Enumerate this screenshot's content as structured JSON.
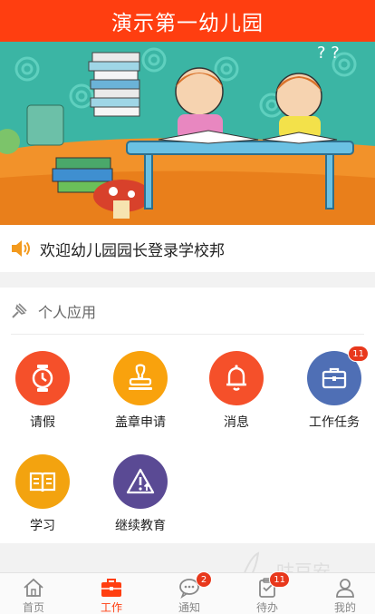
{
  "header": {
    "title": "演示第一幼儿园"
  },
  "banner": {
    "alt": "illustration"
  },
  "notice": {
    "text": "欢迎幼儿园园长登录学校邦"
  },
  "apps": {
    "section_title": "个人应用",
    "items": [
      {
        "label": "请假",
        "icon": "clock-icon",
        "color": "#f5502a"
      },
      {
        "label": "盖章申请",
        "icon": "stamp-icon",
        "color": "#f9a20d"
      },
      {
        "label": "消息",
        "icon": "bell-icon",
        "color": "#f5502a"
      },
      {
        "label": "工作任务",
        "icon": "briefcase-icon",
        "color": "#4f6fb5",
        "badge": "11"
      },
      {
        "label": "学习",
        "icon": "book-icon",
        "color": "#f3a30f"
      },
      {
        "label": "继续教育",
        "icon": "warning-icon",
        "color": "#5a4a94"
      }
    ]
  },
  "tabbar": {
    "items": [
      {
        "label": "首页",
        "icon": "home-icon"
      },
      {
        "label": "工作",
        "icon": "briefcase-icon",
        "active": true
      },
      {
        "label": "通知",
        "icon": "chat-icon",
        "badge": "2"
      },
      {
        "label": "待办",
        "icon": "clipboard-icon",
        "badge": "11"
      },
      {
        "label": "我的",
        "icon": "user-icon"
      }
    ]
  },
  "watermark": {
    "text": "咕豆安"
  },
  "colors": {
    "accent": "#ff3e10",
    "badge": "#e8381c"
  }
}
